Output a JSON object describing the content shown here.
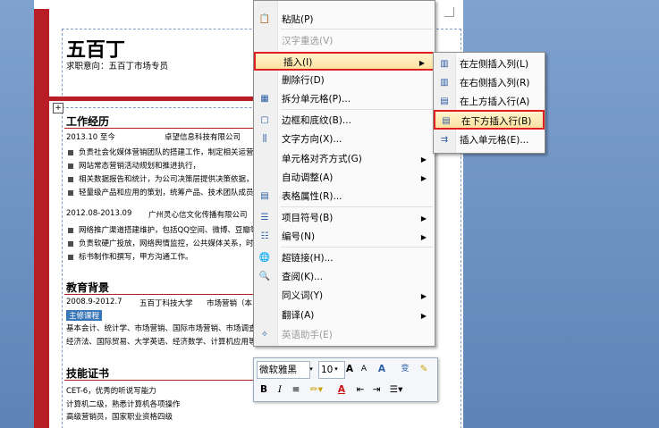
{
  "resume": {
    "name": "五百丁",
    "intent": "求职意向：五百丁市场专员",
    "sections": {
      "experience": "工作经历",
      "education": "教育背景",
      "certs": "技能证书"
    },
    "job1": {
      "date": "2013.10 至今",
      "company": "卓望信息科技有限公司"
    },
    "job1_items": [
      "负责社会化媒体营销团队的搭建工作，制定相关运营策略",
      "网站常态营销活动规划和推进执行，",
      "相关数据报告和统计，为公司决策层提供决策依据，",
      "轻量级产品和应用的策划，统筹产品、技术团队成员实施"
    ],
    "job2": {
      "date": "2012.08-2013.09",
      "company": "广州灵心信文化传播有限公司"
    },
    "job2_items": [
      "网络推广渠道搭建维护，包括QQ空间、微博、豆瓣等",
      "负责软硬广投放，网络舆情监控，公共媒体关系，时间营销",
      "标书制作和撰写，甲方沟通工作。"
    ],
    "edu": {
      "date": "2008.9-2012.7",
      "school": "五百丁科技大学",
      "major": "市场营销（本"
    },
    "course_tag": "主修课程",
    "course_lines": [
      "基本会计、统计学、市场营销、国际市场营销、市场调查与预",
      "经济法、国际贸易、大学英语、经济数学、计算机应用等"
    ],
    "cert_lines": [
      "CET-6，优秀的听说写能力",
      "计算机二级，熟悉计算机各项操作",
      "高级营销员，国家职业资格四级"
    ]
  },
  "context_menu": {
    "items": [
      {
        "label": "粘贴(P)",
        "disabled": false,
        "icon": "paste-icon",
        "glyph": "📋",
        "arrow": false
      },
      {
        "label": "汉字重选(V)",
        "disabled": true,
        "icon": "",
        "glyph": "",
        "arrow": false
      },
      {
        "label": "插入(I)",
        "disabled": false,
        "icon": "",
        "glyph": "",
        "arrow": true,
        "highlight": true
      },
      {
        "label": "删除行(D)",
        "disabled": false,
        "icon": "",
        "glyph": "",
        "arrow": false
      },
      {
        "label": "拆分单元格(P)...",
        "disabled": false,
        "icon": "split-cells-icon",
        "glyph": "▦",
        "arrow": false
      },
      {
        "label": "边框和底纹(B)...",
        "disabled": false,
        "icon": "borders-icon",
        "glyph": "▢",
        "arrow": false
      },
      {
        "label": "文字方向(X)...",
        "disabled": false,
        "icon": "text-direction-icon",
        "glyph": "⫼",
        "arrow": false
      },
      {
        "label": "单元格对齐方式(G)",
        "disabled": false,
        "icon": "",
        "glyph": "",
        "arrow": true
      },
      {
        "label": "自动调整(A)",
        "disabled": false,
        "icon": "",
        "glyph": "",
        "arrow": true
      },
      {
        "label": "表格属性(R)...",
        "disabled": false,
        "icon": "table-properties-icon",
        "glyph": "▤",
        "arrow": false
      },
      {
        "label": "项目符号(B)",
        "disabled": false,
        "icon": "bullets-icon",
        "glyph": "☰",
        "arrow": true
      },
      {
        "label": "编号(N)",
        "disabled": false,
        "icon": "numbering-icon",
        "glyph": "☷",
        "arrow": true
      },
      {
        "label": "超链接(H)...",
        "disabled": false,
        "icon": "hyperlink-icon",
        "glyph": "🌐",
        "arrow": false
      },
      {
        "label": "查阅(K)...",
        "disabled": false,
        "icon": "research-icon",
        "glyph": "🔍",
        "arrow": false
      },
      {
        "label": "同义词(Y)",
        "disabled": false,
        "icon": "",
        "glyph": "",
        "arrow": true
      },
      {
        "label": "翻译(A)",
        "disabled": false,
        "icon": "",
        "glyph": "",
        "arrow": true
      },
      {
        "label": "英语助手(E)",
        "disabled": true,
        "icon": "english-assistant-icon",
        "glyph": "✧",
        "arrow": false
      }
    ]
  },
  "insert_submenu": {
    "items": [
      {
        "label": "在左侧插入列(L)",
        "icon": "insert-column-left-icon",
        "glyph": "▥"
      },
      {
        "label": "在右侧插入列(R)",
        "icon": "insert-column-right-icon",
        "glyph": "▥"
      },
      {
        "label": "在上方插入行(A)",
        "icon": "insert-row-above-icon",
        "glyph": "▤"
      },
      {
        "label": "在下方插入行(B)",
        "icon": "insert-row-below-icon",
        "glyph": "▤",
        "highlight": true
      },
      {
        "label": "插入单元格(E)...",
        "icon": "insert-cells-icon",
        "glyph": "⇉"
      }
    ]
  },
  "mini_toolbar": {
    "font": "微软雅黑",
    "size": "10",
    "grow": "A",
    "shrink": "A",
    "styles": "A",
    "phonetic": "变",
    "bold": "B",
    "italic": "I",
    "color_a": "A"
  }
}
